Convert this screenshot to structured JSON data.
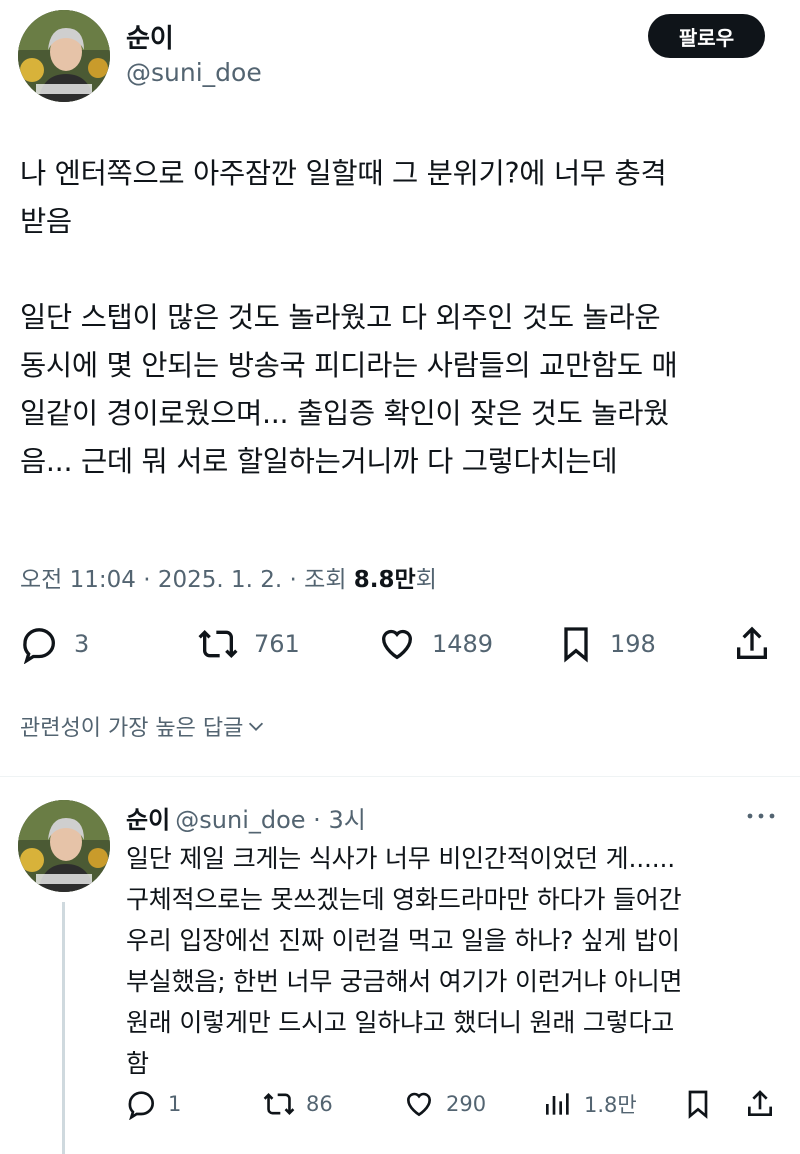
{
  "tweet": {
    "author_name": "순이",
    "author_handle": "@suni_doe",
    "follow_label": "팔로우",
    "paragraph1_line1": "나 엔터쪽으로 아주잠깐 일할때 그 분위기?에 너무 충격",
    "paragraph1_line2": "받음",
    "paragraph2_line1": "일단 스탭이 많은 것도 놀라웠고 다 외주인 것도 놀라운",
    "paragraph2_line2": "동시에 몇 안되는 방송국 피디라는 사람들의 교만함도 매",
    "paragraph2_line3": "일같이 경이로웠으며... 출입증 확인이 잦은 것도 놀라웠",
    "paragraph2_line4": "음... 근데 뭐 서로 할일하는거니까 다 그렇다치는데",
    "time": "오전 11:04",
    "date": "2025. 1. 2.",
    "views_label": "조회",
    "views_count": "8.8만",
    "views_suffix": "회",
    "replies": "3",
    "retweets": "761",
    "likes": "1489",
    "bookmarks": "198"
  },
  "sort": {
    "label": "관련성이 가장 높은 답글"
  },
  "reply": {
    "author_name": "순이",
    "author_handle": "@suni_doe",
    "time_ago": "3시",
    "line1": "일단 제일 크게는 식사가 너무 비인간적이었던 게......",
    "line2": "구체적으로는 못쓰겠는데 영화드라마만 하다가 들어간",
    "line3": "우리 입장에선 진짜 이런걸 먹고 일을 하나? 싶게 밥이",
    "line4": "부실했음; 한번 너무 궁금해서 여기가 이런거냐 아니면",
    "line5": "원래 이렇게만 드시고 일하냐고 했더니 원래 그렇다고",
    "line6": "함",
    "replies": "1",
    "retweets": "86",
    "likes": "290",
    "views": "1.8만"
  },
  "colors": {
    "text": "#0f1419",
    "secondary": "#536471",
    "button": "#0f1419"
  }
}
